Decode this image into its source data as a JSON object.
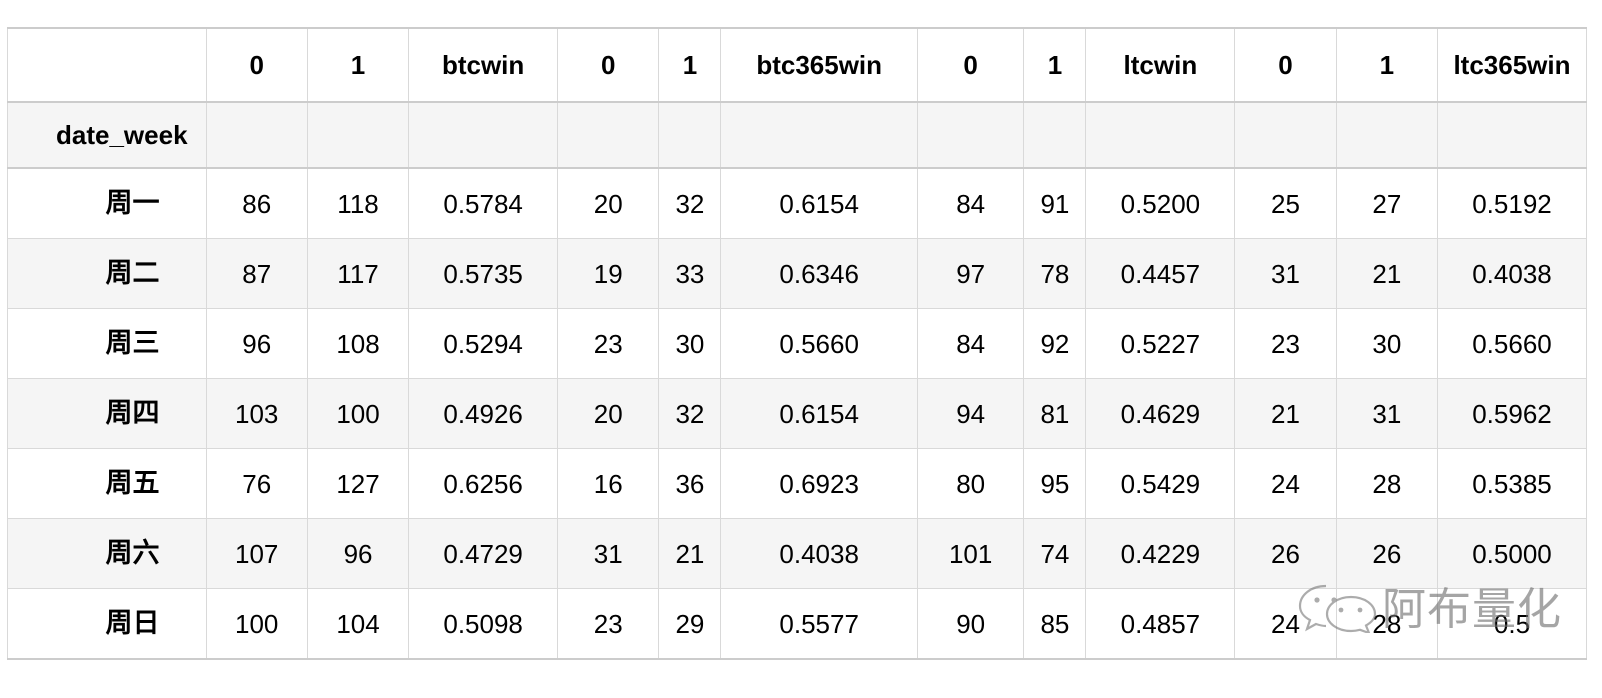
{
  "table": {
    "index_name": "date_week",
    "columns": [
      "0",
      "1",
      "btcwin",
      "0",
      "1",
      "btc365win",
      "0",
      "1",
      "ltcwin",
      "0",
      "1",
      "ltc365win"
    ],
    "rows": [
      {
        "index": "周一",
        "values": [
          "86",
          "118",
          "0.5784",
          "20",
          "32",
          "0.6154",
          "84",
          "91",
          "0.5200",
          "25",
          "27",
          "0.5192"
        ]
      },
      {
        "index": "周二",
        "values": [
          "87",
          "117",
          "0.5735",
          "19",
          "33",
          "0.6346",
          "97",
          "78",
          "0.4457",
          "31",
          "21",
          "0.4038"
        ]
      },
      {
        "index": "周三",
        "values": [
          "96",
          "108",
          "0.5294",
          "23",
          "30",
          "0.5660",
          "84",
          "92",
          "0.5227",
          "23",
          "30",
          "0.5660"
        ]
      },
      {
        "index": "周四",
        "values": [
          "103",
          "100",
          "0.4926",
          "20",
          "32",
          "0.6154",
          "94",
          "81",
          "0.4629",
          "21",
          "31",
          "0.5962"
        ]
      },
      {
        "index": "周五",
        "values": [
          "76",
          "127",
          "0.6256",
          "16",
          "36",
          "0.6923",
          "80",
          "95",
          "0.5429",
          "24",
          "28",
          "0.5385"
        ]
      },
      {
        "index": "周六",
        "values": [
          "107",
          "96",
          "0.4729",
          "31",
          "21",
          "0.4038",
          "101",
          "74",
          "0.4229",
          "26",
          "26",
          "0.5000"
        ]
      },
      {
        "index": "周日",
        "values": [
          "100",
          "104",
          "0.5098",
          "23",
          "29",
          "0.5577",
          "90",
          "85",
          "0.4857",
          "24",
          "28",
          "0.5"
        ]
      }
    ]
  },
  "watermark": {
    "text": "阿布量化",
    "logo": "wechat-logo"
  },
  "colors": {
    "border": "#d9d9d9",
    "border_strong": "#cccccc",
    "row_alt": "#f5f5f5",
    "row_base": "#ffffff",
    "text": "#000000",
    "watermark": "#6f6f6f"
  }
}
